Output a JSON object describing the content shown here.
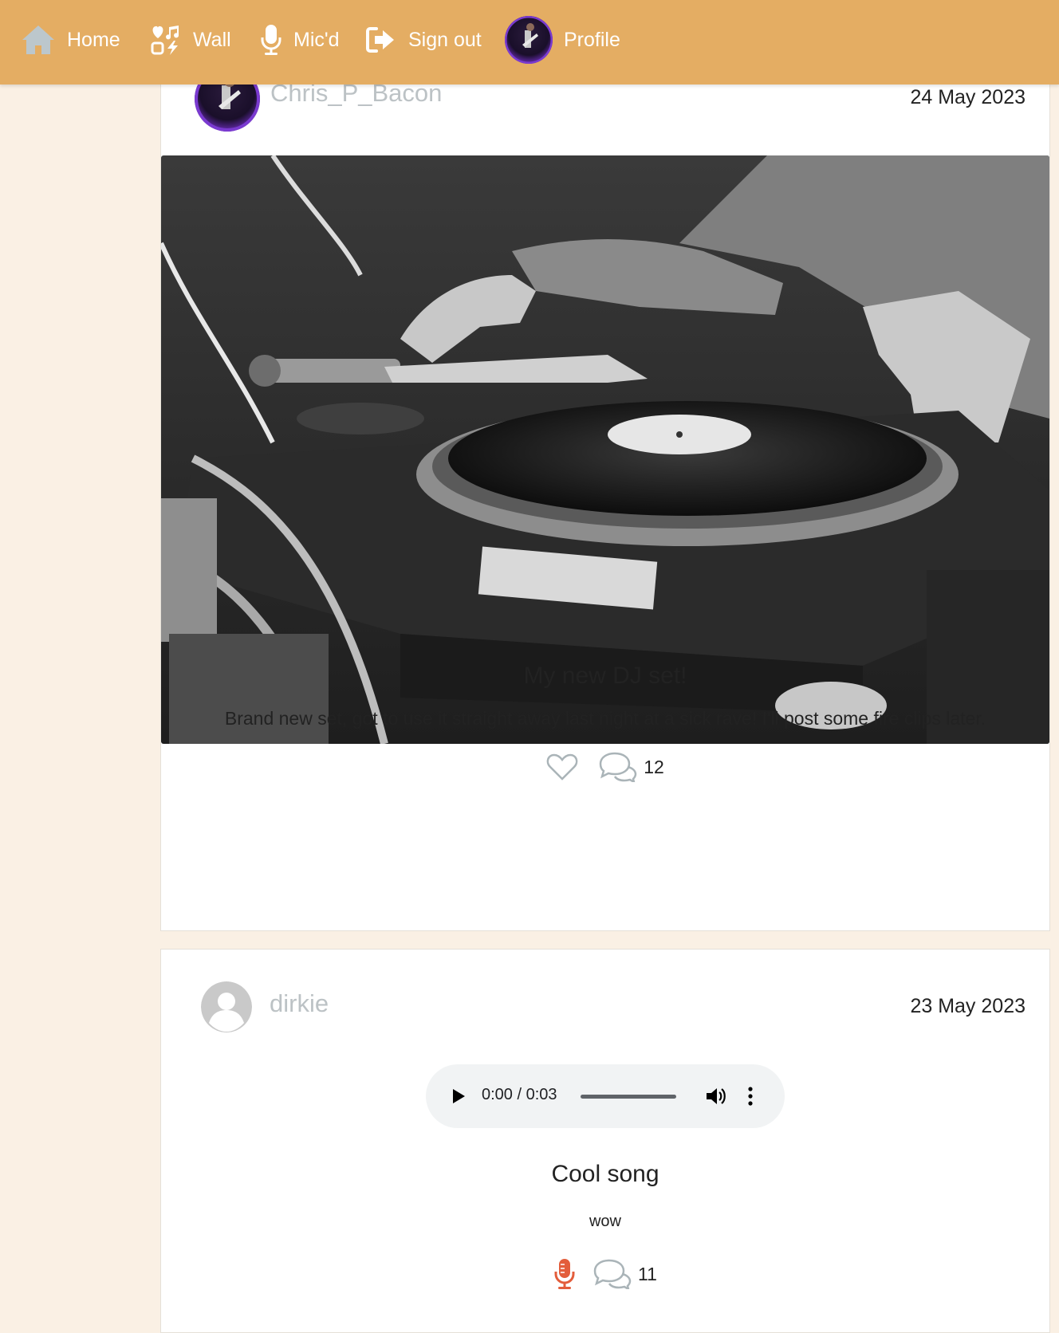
{
  "nav": {
    "home": "Home",
    "wall": "Wall",
    "micd": "Mic'd",
    "signout": "Sign out",
    "profile": "Profile"
  },
  "posts": [
    {
      "author": "Chris_P_Bacon",
      "date": "24 May 2023",
      "title": "My new DJ set!",
      "body": "Brand new set, got to use it straight away last night at a sick rave! I'll post some fire clips later.",
      "comment_count": "12",
      "media": "turntable-photo"
    },
    {
      "author": "dirkie",
      "date": "23 May 2023",
      "title": "Cool song",
      "body": "wow",
      "comment_count": "11",
      "audio": {
        "time": "0:00 / 0:03",
        "progress": 0
      }
    }
  ],
  "colors": {
    "navbar": "#e4ad63",
    "page_background": "#faf0e4",
    "author_name": "#bcc2c5",
    "mic_icon": "#e35d3b"
  },
  "icons": [
    "home-icon",
    "wall-icon",
    "mic-icon",
    "sign-out-icon",
    "heart-icon",
    "comments-icon",
    "play-icon",
    "volume-icon",
    "more-vert-icon"
  ]
}
